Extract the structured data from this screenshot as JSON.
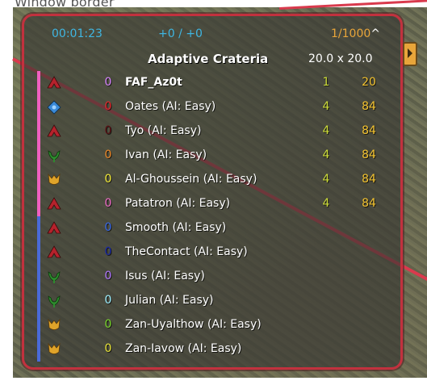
{
  "caption": "Window border",
  "header": {
    "timer": "00:01:23",
    "score": "+0 / +0",
    "units": "1/1000",
    "units_caret": "^",
    "map_name": "Adaptive Crateria",
    "map_size": "20.0 x 20.0"
  },
  "colors": {
    "team1_bar": "#f060c0",
    "team2_bar": "#4a6ad8",
    "panel_border": "#c2313e",
    "timer": "#3fb6e2",
    "units": "#e8a53a",
    "rating": "#cddc39",
    "games": "#f2c230"
  },
  "players": [
    {
      "faction": "uef-icon",
      "faction_color": "#b5222c",
      "team": "0",
      "team_color": "#d986ff",
      "name": "FAF_Az0t",
      "bold": true,
      "rating": "1",
      "games": "20"
    },
    {
      "faction": "aeon-icon",
      "faction_color": "#3a8ad8",
      "team": "0",
      "team_color": "#e8282e",
      "name": "Oates (AI: Easy)",
      "bold": false,
      "rating": "4",
      "games": "84"
    },
    {
      "faction": "uef-icon",
      "faction_color": "#b5222c",
      "team": "0",
      "team_color": "#5a0e12",
      "name": "Tyo (AI: Easy)",
      "bold": false,
      "rating": "4",
      "games": "84"
    },
    {
      "faction": "cybran-icon",
      "faction_color": "#2e8a2e",
      "team": "0",
      "team_color": "#ee8a2a",
      "name": "Ivan (AI: Easy)",
      "bold": false,
      "rating": "4",
      "games": "84"
    },
    {
      "faction": "seraphim-icon",
      "faction_color": "#e0a42a",
      "team": "0",
      "team_color": "#f2ea3a",
      "name": "Al-Ghoussein (AI: Easy)",
      "bold": false,
      "rating": "4",
      "games": "84"
    },
    {
      "faction": "uef-icon",
      "faction_color": "#b5222c",
      "team": "0",
      "team_color": "#f06ec8",
      "name": "Patatron (AI: Easy)",
      "bold": false,
      "rating": "4",
      "games": "84"
    },
    {
      "faction": "uef-icon",
      "faction_color": "#b5222c",
      "team": "0",
      "team_color": "#3a6ae8",
      "name": "Smooth (AI: Easy)",
      "bold": false,
      "rating": "",
      "games": ""
    },
    {
      "faction": "uef-icon",
      "faction_color": "#b5222c",
      "team": "0",
      "team_color": "#1a2aa8",
      "name": "TheContact (AI: Easy)",
      "bold": false,
      "rating": "",
      "games": ""
    },
    {
      "faction": "cybran-icon",
      "faction_color": "#2e8a2e",
      "team": "0",
      "team_color": "#b278ff",
      "name": "Isus (AI: Easy)",
      "bold": false,
      "rating": "",
      "games": ""
    },
    {
      "faction": "cybran-icon",
      "faction_color": "#2e8a2e",
      "team": "0",
      "team_color": "#9ff0ff",
      "name": "Julian (AI: Easy)",
      "bold": false,
      "rating": "",
      "games": ""
    },
    {
      "faction": "seraphim-icon",
      "faction_color": "#e0a42a",
      "team": "0",
      "team_color": "#7ad62e",
      "name": "Zan-Uyalthow (AI: Easy)",
      "bold": false,
      "rating": "",
      "games": ""
    },
    {
      "faction": "seraphim-icon",
      "faction_color": "#e0a42a",
      "team": "0",
      "team_color": "#e8e43a",
      "name": "Zan-Iavow (AI: Easy)",
      "bold": false,
      "rating": "",
      "games": ""
    }
  ]
}
